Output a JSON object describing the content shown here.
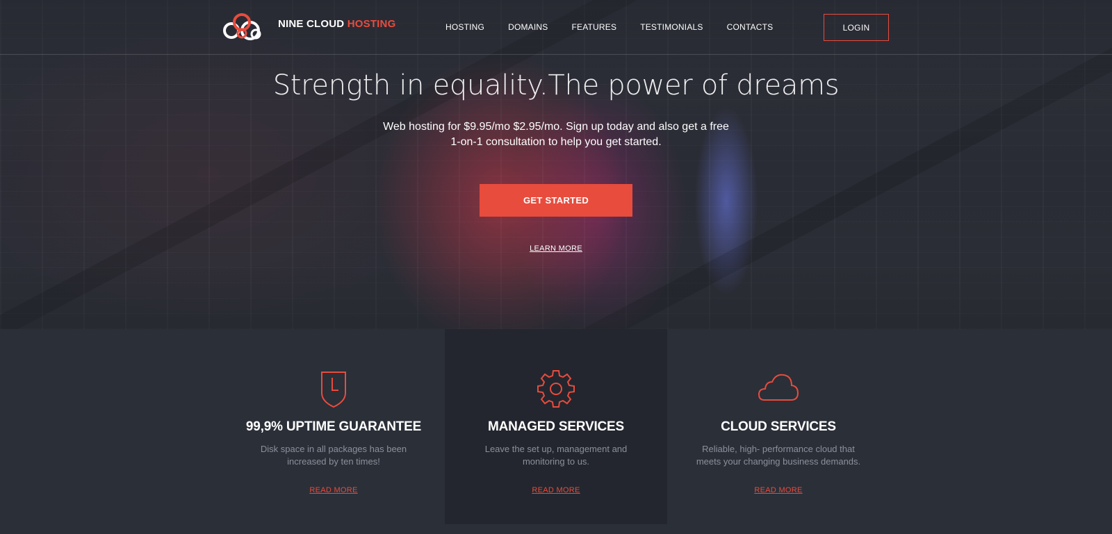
{
  "header": {
    "brand_main": "NINE CLOUD",
    "brand_accent": "HOSTING",
    "nav": [
      "HOSTING",
      "DOMAINS",
      "FEATURES",
      "TESTIMONIALS",
      "CONTACTS"
    ],
    "login_label": "LOGIN"
  },
  "hero": {
    "title": "Strength in equality.The power of dreams",
    "subtitle": "Web hosting for $9.95/mo $2.95/mo. Sign up today and also get a free 1-on-1 consultation to help you get started.",
    "cta_label": "GET STARTED",
    "learn_more_label": "LEARN MORE"
  },
  "features": [
    {
      "icon": "shield-clock-icon",
      "title": "99,9% UPTIME GUARANTEE",
      "text": "Disk space in all packages has been increased by ten times!",
      "link": "READ MORE"
    },
    {
      "icon": "gear-icon",
      "title": "MANAGED SERVICES",
      "text": "Leave the set up, management and monitoring to us.",
      "link": "READ MORE"
    },
    {
      "icon": "cloud-icon",
      "title": "CLOUD SERVICES",
      "text": "Reliable, high- performance cloud that meets your changing business demands.",
      "link": "READ MORE"
    }
  ],
  "colors": {
    "accent": "#e84c3d",
    "background": "#2b2f38",
    "highlight_panel": "#23262e",
    "muted_text": "#8b909b"
  }
}
